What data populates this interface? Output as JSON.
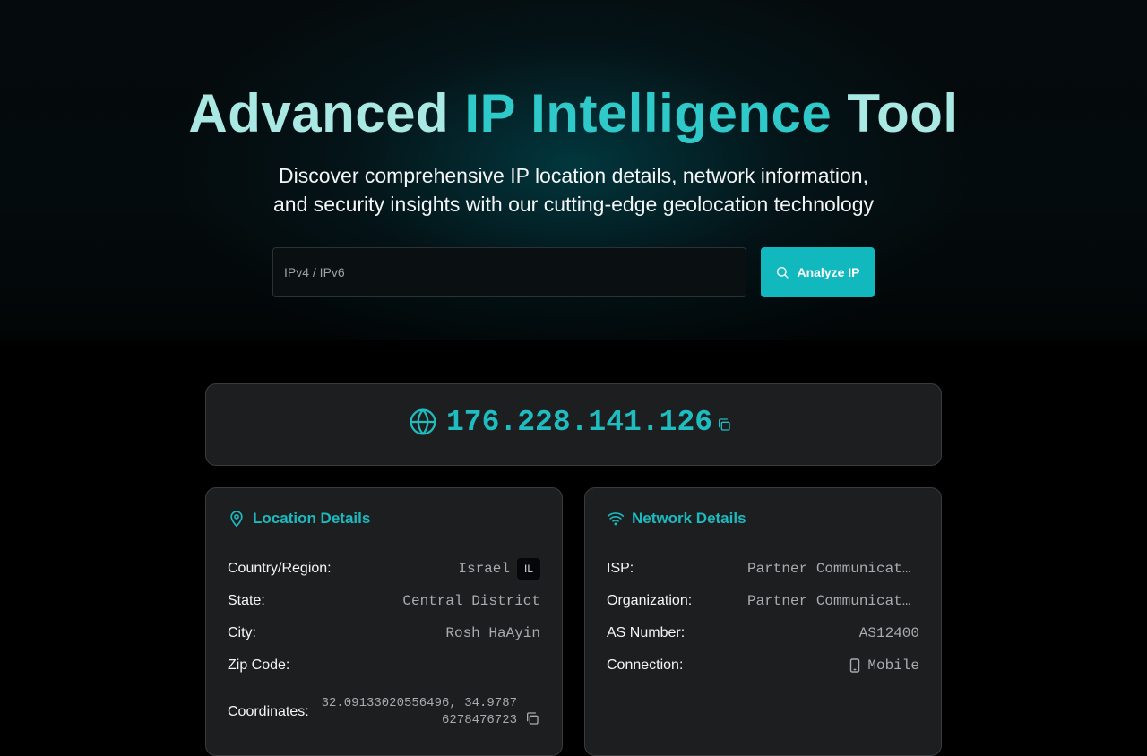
{
  "hero": {
    "title_part1": "Advanced ",
    "title_part2": "IP Intelligence",
    "title_part3": " Tool",
    "subtitle_line1": "Discover comprehensive IP location details, network information,",
    "subtitle_line2": "and security insights with our cutting-edge geolocation technology"
  },
  "search": {
    "placeholder": "IPv4 / IPv6",
    "value": "",
    "button_label": "Analyze IP",
    "button_icon": "search-icon"
  },
  "ip_card": {
    "address": "176.228.141.126",
    "icon": "globe-icon",
    "copy_icon": "copy-icon"
  },
  "location": {
    "title": "Location Details",
    "icon": "map-pin-icon",
    "rows": [
      {
        "label": "Country/Region:",
        "value": "Israel",
        "badge": "IL"
      },
      {
        "label": "State:",
        "value": "Central District"
      },
      {
        "label": "City:",
        "value": "Rosh HaAyin"
      },
      {
        "label": "Zip Code:",
        "value": ""
      },
      {
        "label": "Coordinates:",
        "value": "32.09133020556496, 34.97876278476723"
      }
    ]
  },
  "network": {
    "title": "Network Details",
    "icon": "wifi-icon",
    "rows": [
      {
        "label": "ISP:",
        "value": "Partner Communications"
      },
      {
        "label": "Organization:",
        "value": "Partner Communications"
      },
      {
        "label": "AS Number:",
        "value": "AS12400"
      },
      {
        "label": "Connection:",
        "value": "Mobile",
        "icon": "smartphone-icon"
      }
    ]
  },
  "colors": {
    "accent": "#11b9bf",
    "background": "#000000",
    "card": "#1d1e1f",
    "card_border": "#393b3d",
    "muted_text": "#a8acaf"
  }
}
